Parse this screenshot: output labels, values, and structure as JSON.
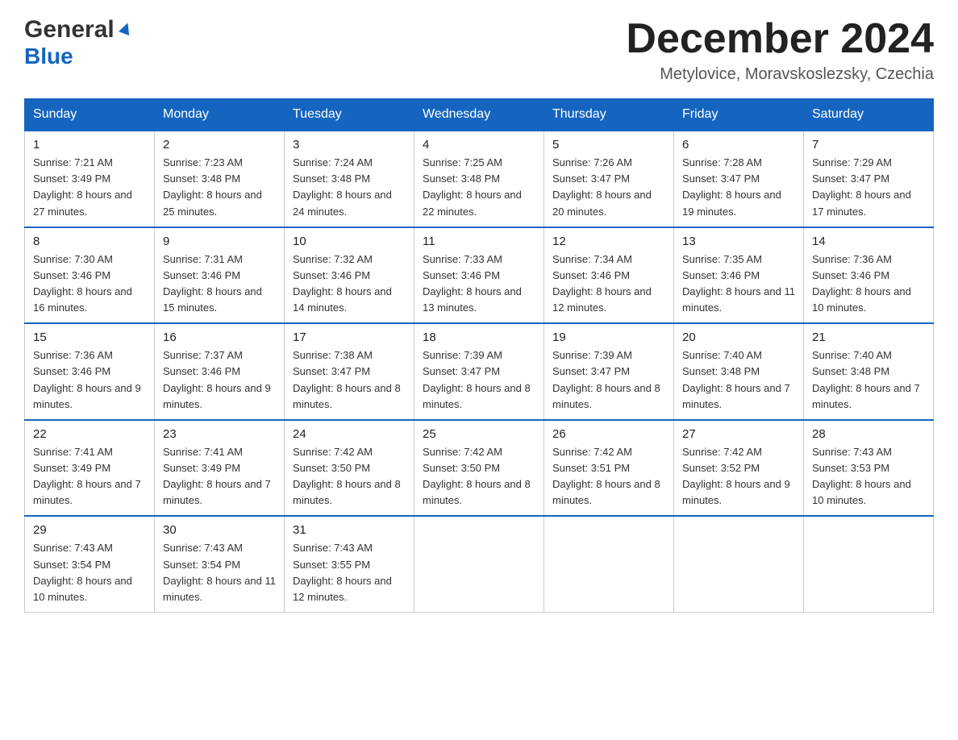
{
  "header": {
    "logo_general": "General",
    "logo_blue": "Blue",
    "month_title": "December 2024",
    "location": "Metylovice, Moravskoslezsky, Czechia"
  },
  "weekdays": [
    "Sunday",
    "Monday",
    "Tuesday",
    "Wednesday",
    "Thursday",
    "Friday",
    "Saturday"
  ],
  "weeks": [
    [
      {
        "day": "1",
        "sunrise": "7:21 AM",
        "sunset": "3:49 PM",
        "daylight": "8 hours and 27 minutes."
      },
      {
        "day": "2",
        "sunrise": "7:23 AM",
        "sunset": "3:48 PM",
        "daylight": "8 hours and 25 minutes."
      },
      {
        "day": "3",
        "sunrise": "7:24 AM",
        "sunset": "3:48 PM",
        "daylight": "8 hours and 24 minutes."
      },
      {
        "day": "4",
        "sunrise": "7:25 AM",
        "sunset": "3:48 PM",
        "daylight": "8 hours and 22 minutes."
      },
      {
        "day": "5",
        "sunrise": "7:26 AM",
        "sunset": "3:47 PM",
        "daylight": "8 hours and 20 minutes."
      },
      {
        "day": "6",
        "sunrise": "7:28 AM",
        "sunset": "3:47 PM",
        "daylight": "8 hours and 19 minutes."
      },
      {
        "day": "7",
        "sunrise": "7:29 AM",
        "sunset": "3:47 PM",
        "daylight": "8 hours and 17 minutes."
      }
    ],
    [
      {
        "day": "8",
        "sunrise": "7:30 AM",
        "sunset": "3:46 PM",
        "daylight": "8 hours and 16 minutes."
      },
      {
        "day": "9",
        "sunrise": "7:31 AM",
        "sunset": "3:46 PM",
        "daylight": "8 hours and 15 minutes."
      },
      {
        "day": "10",
        "sunrise": "7:32 AM",
        "sunset": "3:46 PM",
        "daylight": "8 hours and 14 minutes."
      },
      {
        "day": "11",
        "sunrise": "7:33 AM",
        "sunset": "3:46 PM",
        "daylight": "8 hours and 13 minutes."
      },
      {
        "day": "12",
        "sunrise": "7:34 AM",
        "sunset": "3:46 PM",
        "daylight": "8 hours and 12 minutes."
      },
      {
        "day": "13",
        "sunrise": "7:35 AM",
        "sunset": "3:46 PM",
        "daylight": "8 hours and 11 minutes."
      },
      {
        "day": "14",
        "sunrise": "7:36 AM",
        "sunset": "3:46 PM",
        "daylight": "8 hours and 10 minutes."
      }
    ],
    [
      {
        "day": "15",
        "sunrise": "7:36 AM",
        "sunset": "3:46 PM",
        "daylight": "8 hours and 9 minutes."
      },
      {
        "day": "16",
        "sunrise": "7:37 AM",
        "sunset": "3:46 PM",
        "daylight": "8 hours and 9 minutes."
      },
      {
        "day": "17",
        "sunrise": "7:38 AM",
        "sunset": "3:47 PM",
        "daylight": "8 hours and 8 minutes."
      },
      {
        "day": "18",
        "sunrise": "7:39 AM",
        "sunset": "3:47 PM",
        "daylight": "8 hours and 8 minutes."
      },
      {
        "day": "19",
        "sunrise": "7:39 AM",
        "sunset": "3:47 PM",
        "daylight": "8 hours and 8 minutes."
      },
      {
        "day": "20",
        "sunrise": "7:40 AM",
        "sunset": "3:48 PM",
        "daylight": "8 hours and 7 minutes."
      },
      {
        "day": "21",
        "sunrise": "7:40 AM",
        "sunset": "3:48 PM",
        "daylight": "8 hours and 7 minutes."
      }
    ],
    [
      {
        "day": "22",
        "sunrise": "7:41 AM",
        "sunset": "3:49 PM",
        "daylight": "8 hours and 7 minutes."
      },
      {
        "day": "23",
        "sunrise": "7:41 AM",
        "sunset": "3:49 PM",
        "daylight": "8 hours and 7 minutes."
      },
      {
        "day": "24",
        "sunrise": "7:42 AM",
        "sunset": "3:50 PM",
        "daylight": "8 hours and 8 minutes."
      },
      {
        "day": "25",
        "sunrise": "7:42 AM",
        "sunset": "3:50 PM",
        "daylight": "8 hours and 8 minutes."
      },
      {
        "day": "26",
        "sunrise": "7:42 AM",
        "sunset": "3:51 PM",
        "daylight": "8 hours and 8 minutes."
      },
      {
        "day": "27",
        "sunrise": "7:42 AM",
        "sunset": "3:52 PM",
        "daylight": "8 hours and 9 minutes."
      },
      {
        "day": "28",
        "sunrise": "7:43 AM",
        "sunset": "3:53 PM",
        "daylight": "8 hours and 10 minutes."
      }
    ],
    [
      {
        "day": "29",
        "sunrise": "7:43 AM",
        "sunset": "3:54 PM",
        "daylight": "8 hours and 10 minutes."
      },
      {
        "day": "30",
        "sunrise": "7:43 AM",
        "sunset": "3:54 PM",
        "daylight": "8 hours and 11 minutes."
      },
      {
        "day": "31",
        "sunrise": "7:43 AM",
        "sunset": "3:55 PM",
        "daylight": "8 hours and 12 minutes."
      },
      null,
      null,
      null,
      null
    ]
  ],
  "labels": {
    "sunrise": "Sunrise:",
    "sunset": "Sunset:",
    "daylight": "Daylight:"
  }
}
